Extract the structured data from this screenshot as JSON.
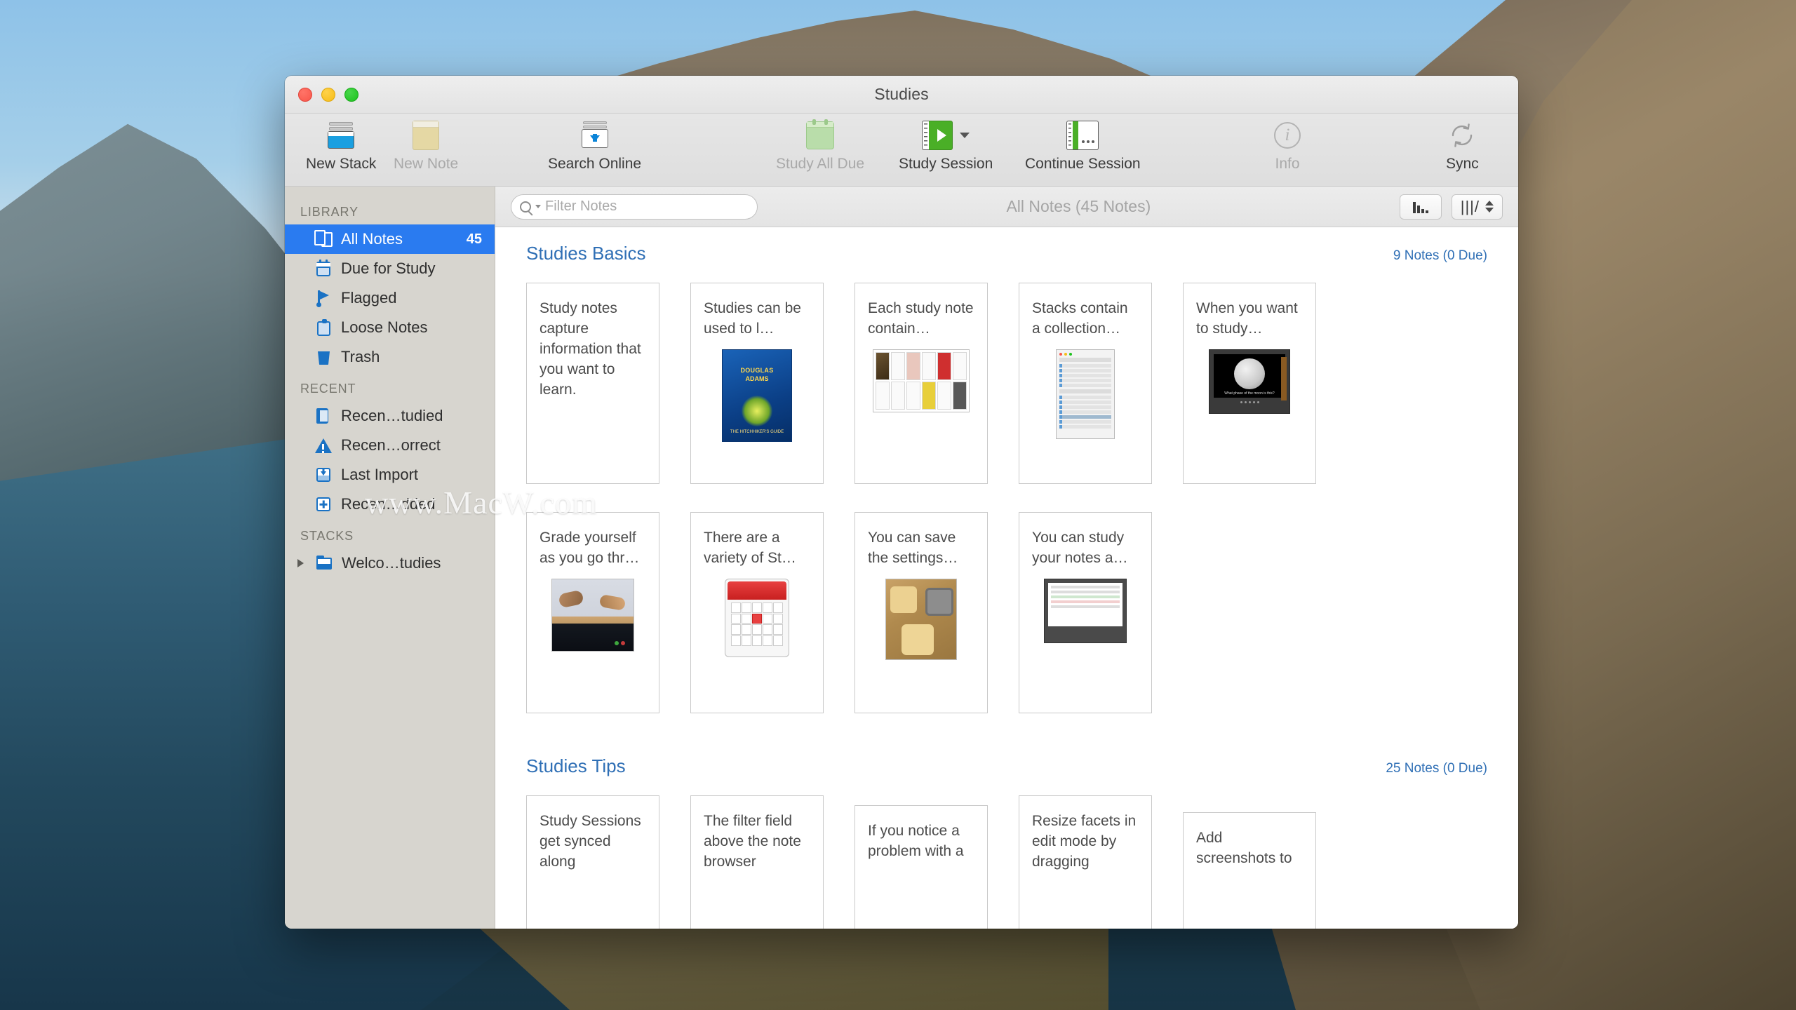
{
  "window": {
    "title": "Studies",
    "traffic_lights": [
      "close-button",
      "minimize-button",
      "zoom-button"
    ]
  },
  "toolbar": {
    "items": [
      {
        "label": "New Stack",
        "icon": "new-stack-icon",
        "disabled": false
      },
      {
        "label": "New Note",
        "icon": "new-note-icon",
        "disabled": true
      },
      {
        "label": "Search Online",
        "icon": "search-online-icon",
        "disabled": false
      },
      {
        "label": "Study All Due",
        "icon": "calendar-icon",
        "disabled": true
      },
      {
        "label": "Study Session",
        "icon": "study-session-icon",
        "disabled": false
      },
      {
        "label": "Continue Session",
        "icon": "continue-session-icon",
        "disabled": false
      },
      {
        "label": "Info",
        "icon": "info-icon",
        "disabled": true
      },
      {
        "label": "Sync",
        "icon": "sync-icon",
        "disabled": false
      }
    ]
  },
  "sidebar": {
    "sections": [
      {
        "header": "LIBRARY",
        "items": [
          {
            "label": "All Notes",
            "icon": "notes-icon",
            "count": "45",
            "selected": true
          },
          {
            "label": "Due for Study",
            "icon": "calendar-icon",
            "count": "",
            "selected": false
          },
          {
            "label": "Flagged",
            "icon": "flag-icon",
            "count": "",
            "selected": false
          },
          {
            "label": "Loose Notes",
            "icon": "clipboard-icon",
            "count": "",
            "selected": false
          },
          {
            "label": "Trash",
            "icon": "trash-icon",
            "count": "",
            "selected": false
          }
        ]
      },
      {
        "header": "RECENT",
        "items": [
          {
            "label": "Recen…tudied",
            "icon": "book-icon",
            "count": "",
            "selected": false
          },
          {
            "label": "Recen…orrect",
            "icon": "warning-icon",
            "count": "",
            "selected": false
          },
          {
            "label": "Last Import",
            "icon": "import-icon",
            "count": "",
            "selected": false
          },
          {
            "label": "Recen…dded",
            "icon": "plus-box-icon",
            "count": "",
            "selected": false
          }
        ]
      },
      {
        "header": "STACKS",
        "items": [
          {
            "label": "Welco…tudies",
            "icon": "folder-icon",
            "count": "",
            "selected": false,
            "disclosure": true
          }
        ]
      }
    ]
  },
  "filter_bar": {
    "search_placeholder": "Filter Notes",
    "search_value": "",
    "scope_title": "All Notes (45 Notes)",
    "stats_button": "stats-icon",
    "layout_glyph": "|||/"
  },
  "note_sections": [
    {
      "title": "Studies Basics",
      "meta": "9 Notes (0 Due)",
      "rows": [
        [
          {
            "text": "Study notes capture information that you want to learn.",
            "thumb": "none",
            "stacked": false
          },
          {
            "text": "Studies can be used to l…",
            "thumb": "book",
            "stacked": true
          },
          {
            "text": "Each study note contain…",
            "thumb": "grid",
            "stacked": true
          },
          {
            "text": "Stacks contain a collection…",
            "thumb": "window",
            "stacked": true
          },
          {
            "text": "When you want to study…",
            "thumb": "screen",
            "stacked": true
          }
        ],
        [
          {
            "text": "Grade yourself as you go thr…",
            "thumb": "hands",
            "stacked": true
          },
          {
            "text": "There are a variety of St…",
            "thumb": "cal",
            "stacked": true
          },
          {
            "text": "You can save the settings…",
            "thumb": "cookies",
            "stacked": true
          },
          {
            "text": "You can study your notes a…",
            "thumb": "app",
            "stacked": true
          }
        ]
      ]
    },
    {
      "title": "Studies Tips",
      "meta": "25 Notes (0 Due)",
      "rows": [
        [
          {
            "text": "Study Sessions get synced along",
            "thumb": "none",
            "stacked": false
          },
          {
            "text": "The filter field above the note browser",
            "thumb": "none",
            "stacked": false
          },
          {
            "text": "If you notice a problem with a",
            "thumb": "none",
            "stacked": false
          },
          {
            "text": "Resize facets in edit mode by dragging",
            "thumb": "none",
            "stacked": false
          },
          {
            "text": "Add screenshots to",
            "thumb": "none",
            "stacked": false
          }
        ]
      ]
    }
  ],
  "watermark": "www.MacW.com",
  "colors": {
    "accent_blue": "#2a7bf0",
    "section_link": "#2f6fb5",
    "sidebar_bg": "#d7d5cf",
    "toolbar_bg": "#e4e4e4",
    "icon_blue": "#1a72c4",
    "green": "#4aaf27"
  }
}
